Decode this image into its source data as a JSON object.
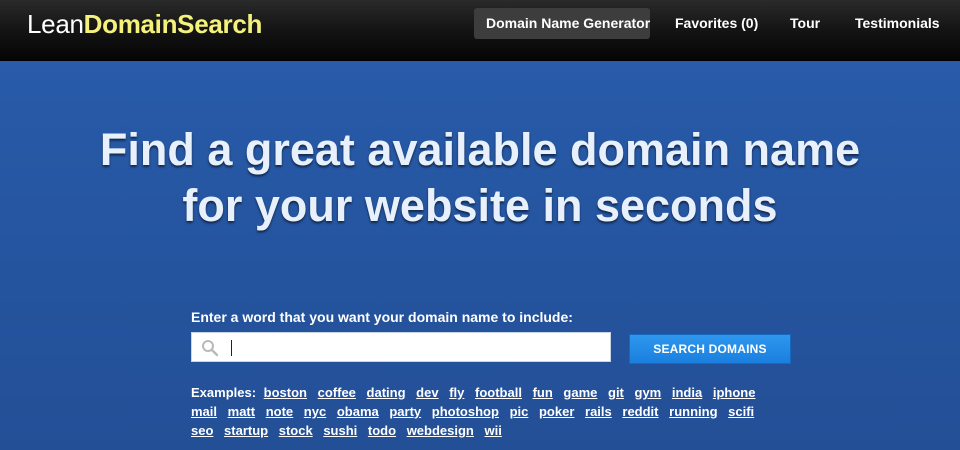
{
  "logo": {
    "part1": "Lean",
    "part2": "DomainSearch"
  },
  "nav": {
    "generator": "Domain Name Generator",
    "favorites": "Favorites (0)",
    "tour": "Tour",
    "testimonials": "Testimonials"
  },
  "hero": {
    "line1": "Find a great available domain name",
    "line2": "for your website in seconds"
  },
  "search": {
    "prompt": "Enter a word that you want your domain name to include:",
    "value": "",
    "button": "SEARCH DOMAINS"
  },
  "examples": {
    "label": "Examples:",
    "items": [
      "boston",
      "coffee",
      "dating",
      "dev",
      "fly",
      "football",
      "fun",
      "game",
      "git",
      "gym",
      "india",
      "iphone",
      "mail",
      "matt",
      "note",
      "nyc",
      "obama",
      "party",
      "photoshop",
      "pic",
      "poker",
      "rails",
      "reddit",
      "running",
      "scifi",
      "seo",
      "startup",
      "stock",
      "sushi",
      "todo",
      "webdesign",
      "wii"
    ]
  },
  "colors": {
    "navbar": "#0a0a0a",
    "logo_accent": "#f4f27a",
    "hero_bg": "#275aa8",
    "button": "#1a7fdf"
  },
  "icons": {
    "search": "magnifier-icon"
  }
}
